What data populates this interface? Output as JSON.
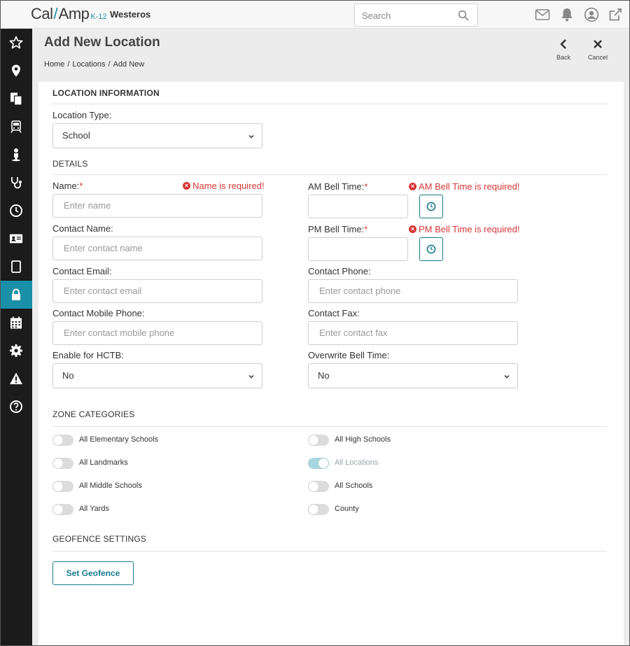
{
  "app": {
    "logo_main": "Cal",
    "logo_amp": "Amp",
    "logo_sub": "K-12",
    "org_name": "Westeros"
  },
  "search": {
    "placeholder": "Search"
  },
  "topbar_icons": [
    "envelope-icon",
    "bell-icon",
    "user-icon",
    "external-link-icon"
  ],
  "sidebar": {
    "items": [
      {
        "icon": "star-icon"
      },
      {
        "icon": "map-pin-icon"
      },
      {
        "icon": "documents-icon"
      },
      {
        "icon": "bus-icon"
      },
      {
        "icon": "person-icon"
      },
      {
        "icon": "stethoscope-icon"
      },
      {
        "icon": "clock-icon"
      },
      {
        "icon": "id-card-icon"
      },
      {
        "icon": "tablet-icon"
      },
      {
        "icon": "lock-icon",
        "active": true
      },
      {
        "icon": "calendar-icon"
      },
      {
        "icon": "gear-icon"
      },
      {
        "icon": "warning-icon"
      },
      {
        "icon": "help-icon"
      }
    ]
  },
  "page": {
    "title": "Add New Location",
    "breadcrumb": [
      "Home",
      "Locations",
      "Add New"
    ],
    "back_label": "Back",
    "cancel_label": "Cancel"
  },
  "location_info": {
    "section_title": "LOCATION INFORMATION",
    "type_label": "Location Type:",
    "type_value": "School"
  },
  "details": {
    "section_title": "DETAILS",
    "name_label": "Name:",
    "name_error": "Name is required!",
    "name_placeholder": "Enter name",
    "am_label": "AM Bell Time:",
    "am_error": "AM Bell Time is required!",
    "pm_label": "PM Bell Time:",
    "pm_error": "PM Bell Time is required!",
    "required_mark": "*",
    "contact_name_label": "Contact Name:",
    "contact_name_placeholder": "Enter contact name",
    "contact_email_label": "Contact Email:",
    "contact_email_placeholder": "Enter contact email",
    "contact_phone_label": "Contact Phone:",
    "contact_phone_placeholder": "Enter contact phone",
    "contact_mobile_label": "Contact Mobile Phone:",
    "contact_mobile_placeholder": "Enter contact mobile phone",
    "contact_fax_label": "Contact Fax:",
    "contact_fax_placeholder": "Enter contact fax",
    "hctb_label": "Enable for HCTB:",
    "hctb_value": "No",
    "overwrite_label": "Overwrite Bell Time:",
    "overwrite_value": "No"
  },
  "zones": {
    "section_title": "ZONE CATEGORIES",
    "items": [
      {
        "label": "All Elementary Schools",
        "on": false
      },
      {
        "label": "All High Schools",
        "on": false
      },
      {
        "label": "All Landmarks",
        "on": false
      },
      {
        "label": "All Locations",
        "on": true,
        "disabled": true
      },
      {
        "label": "All Middle Schools",
        "on": false
      },
      {
        "label": "All Schools",
        "on": false
      },
      {
        "label": "All Yards",
        "on": false
      },
      {
        "label": "County",
        "on": false
      }
    ]
  },
  "geofence": {
    "section_title": "GEOFENCE SETTINGS",
    "button_label": "Set Geofence"
  },
  "colors": {
    "accent": "#1a8fa8",
    "error": "#d93636",
    "sidebar_bg": "#1b1b1b"
  }
}
